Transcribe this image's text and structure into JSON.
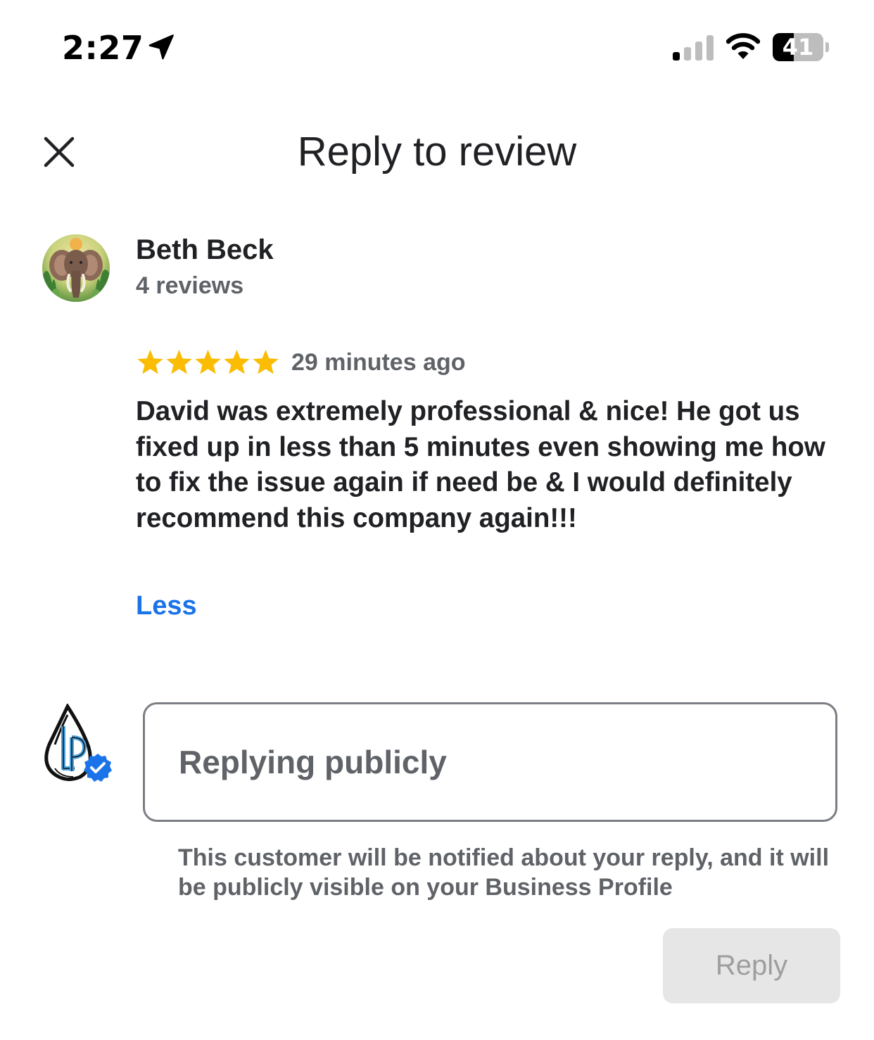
{
  "status_bar": {
    "time": "2:27",
    "battery_level": "41",
    "battery_fraction": 0.41,
    "signal_bars_active": 1,
    "signal_bars_total": 4,
    "icons": [
      "location-arrow-icon",
      "cellular-signal-icon",
      "wifi-icon",
      "battery-icon"
    ]
  },
  "header": {
    "title": "Reply to review",
    "close_icon": "close-icon"
  },
  "reviewer": {
    "name": "Beth Beck",
    "review_count": "4 reviews",
    "avatar_icon": "elephant-avatar"
  },
  "review": {
    "rating": 5,
    "rating_max": 5,
    "star_color": "#fbbc04",
    "time_ago": "29 minutes ago",
    "text": "David was extremely professional & nice! He got us fixed up in less than 5 minutes even showing me how to fix the issue again if need be & I would definitely recommend this company again!!!",
    "less_label": "Less"
  },
  "reply": {
    "placeholder": "Replying publicly",
    "value": "",
    "notice": "This customer will be notified about your reply, and it will be publicly visible on your Business Profile",
    "button_label": "Reply",
    "logo_icon": "water-drop-logo",
    "verified_icon": "verified-badge-icon"
  },
  "colors": {
    "accent_link": "#1a73e8",
    "verified_badge": "#1a73e8",
    "text_primary": "#202124",
    "text_secondary": "#5f6368",
    "button_disabled_bg": "#e6e6e6",
    "button_disabled_text": "#9e9e9e"
  }
}
